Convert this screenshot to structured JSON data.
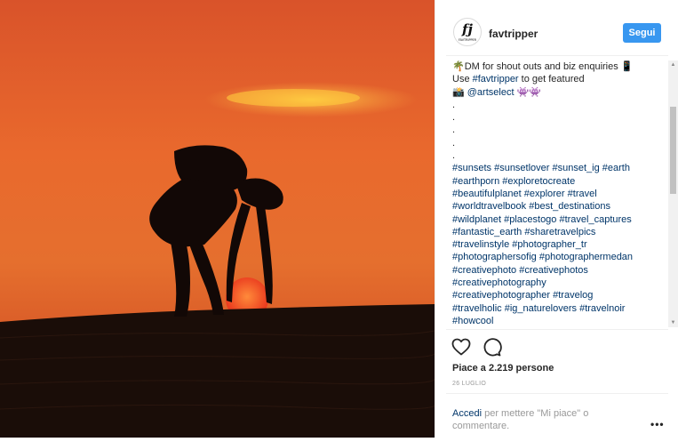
{
  "post": {
    "username": "favtripper",
    "follow_label": "Segui",
    "avatar_text": "fj",
    "avatar_subtext": "FAVTRIPPER",
    "caption_lines": [
      [
        {
          "t": "🌴DM for shout outs and biz enquiries 📱"
        }
      ],
      [
        {
          "t": "Use "
        },
        {
          "t": "#favtripper",
          "tag": true
        },
        {
          "t": " to get featured"
        }
      ],
      [
        {
          "t": "📸 "
        },
        {
          "t": "@artselect",
          "tag": true
        },
        {
          "t": " 👾👾"
        }
      ],
      [
        {
          "t": "."
        }
      ],
      [
        {
          "t": "."
        }
      ],
      [
        {
          "t": "."
        }
      ],
      [
        {
          "t": "."
        }
      ],
      [
        {
          "t": "."
        }
      ],
      [
        {
          "t": "#sunsets #sunsetlover #sunset_ig #earth",
          "tag": true
        }
      ],
      [
        {
          "t": "#earthporn #exploretocreate",
          "tag": true
        }
      ],
      [
        {
          "t": "#beautifulplanet #explorer #travel",
          "tag": true
        }
      ],
      [
        {
          "t": "#worldtravelbook #best_destinations",
          "tag": true
        }
      ],
      [
        {
          "t": "#wildplanet #placestogo #travel_captures",
          "tag": true
        }
      ],
      [
        {
          "t": "#fantastic_earth #sharetravelpics",
          "tag": true
        }
      ],
      [
        {
          "t": "#travelinstyle #photographer_tr",
          "tag": true
        }
      ],
      [
        {
          "t": "#photographersofig #photographermedan",
          "tag": true
        }
      ],
      [
        {
          "t": "#creativephoto #creativephotos",
          "tag": true
        }
      ],
      [
        {
          "t": "#creativephotography",
          "tag": true
        }
      ],
      [
        {
          "t": "#creativephotographer #travelog",
          "tag": true
        }
      ],
      [
        {
          "t": "#travelholic #ig_naturelovers #travelnoir",
          "tag": true
        }
      ],
      [
        {
          "t": "#howcool",
          "tag": true
        }
      ]
    ],
    "likes_text": "Piace a 2.219 persone",
    "date_text": "26 LUGLIO",
    "comment_link": "Accedi",
    "comment_rest": " per mettere \"Mi piace\" o commentare.",
    "more_label": "•••",
    "icons": {
      "like": "heart-icon",
      "comment": "comment-icon"
    }
  }
}
